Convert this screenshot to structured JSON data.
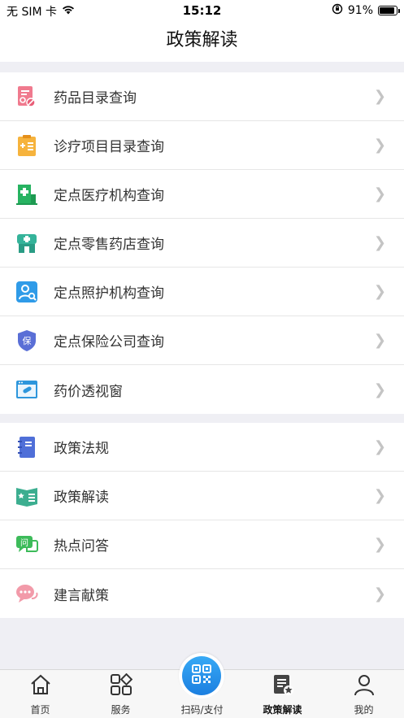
{
  "status_bar": {
    "carrier": "无 SIM 卡",
    "time": "15:12",
    "battery_percent": "91%",
    "battery_level": 0.91
  },
  "nav": {
    "title": "政策解读"
  },
  "group1": [
    {
      "label": "药品目录查询",
      "icon": "drug-catalog-icon"
    },
    {
      "label": "诊疗项目目录查询",
      "icon": "treatment-list-icon"
    },
    {
      "label": "定点医疗机构查询",
      "icon": "hospital-icon"
    },
    {
      "label": "定点零售药店查询",
      "icon": "pharmacy-icon"
    },
    {
      "label": "定点照护机构查询",
      "icon": "care-search-icon"
    },
    {
      "label": "定点保险公司查询",
      "icon": "insurance-shield-icon"
    },
    {
      "label": "药价透视窗",
      "icon": "price-window-icon"
    }
  ],
  "group2": [
    {
      "label": "政策法规",
      "icon": "notebook-icon"
    },
    {
      "label": "政策解读",
      "icon": "book-star-icon"
    },
    {
      "label": "热点问答",
      "icon": "qa-chat-icon"
    },
    {
      "label": "建言献策",
      "icon": "suggestion-bubble-icon"
    }
  ],
  "tabs": {
    "home": "首页",
    "service": "服务",
    "scan": "扫码/支付",
    "policy": "政策解读",
    "mine": "我的"
  },
  "colors": {
    "accent": "#1c87e6",
    "background": "#efeff4"
  }
}
